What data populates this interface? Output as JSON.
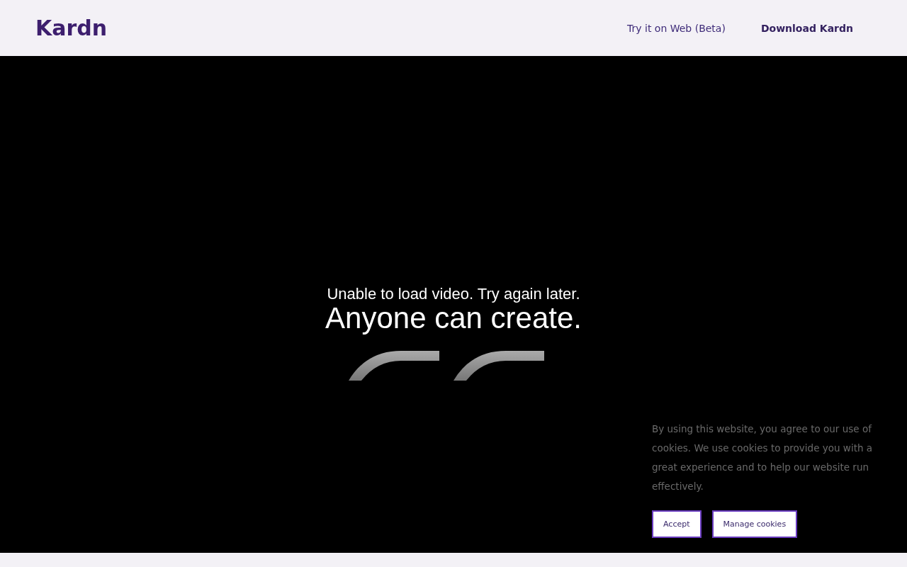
{
  "header": {
    "logo": "Kardn",
    "nav": [
      {
        "label": "Try it on Web (Beta)",
        "kind": "link"
      },
      {
        "label": "Download Kardn",
        "kind": "strong"
      }
    ]
  },
  "hero": {
    "video_error": "Unable to load video. Try again later.",
    "headline": "Anyone can create."
  },
  "cookie_banner": {
    "message": "By using this website, you agree to our use of cookies. We use cookies to provide you with a great experience and to help our website run effectively.",
    "buttons": [
      "Accept",
      "Manage cookies"
    ]
  }
}
